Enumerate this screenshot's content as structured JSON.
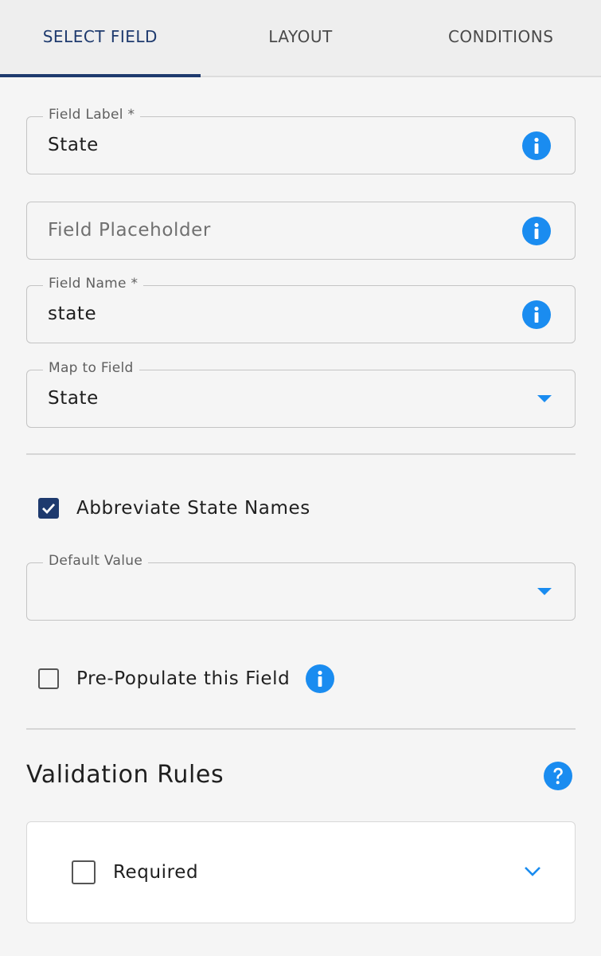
{
  "tabs": [
    {
      "label": "SELECT FIELD",
      "active": true
    },
    {
      "label": "LAYOUT",
      "active": false
    },
    {
      "label": "CONDITIONS",
      "active": false
    }
  ],
  "fields": {
    "field_label": {
      "legend": "Field Label *",
      "value": "State",
      "icon": "info-icon"
    },
    "field_placeholder": {
      "placeholder": "Field Placeholder",
      "value": "",
      "icon": "info-icon"
    },
    "field_name": {
      "legend": "Field Name *",
      "value": "state",
      "icon": "info-icon"
    },
    "map_to_field": {
      "legend": "Map to Field",
      "value": "State",
      "icon": "caret-down-icon"
    }
  },
  "abbreviate": {
    "label": "Abbreviate State Names",
    "checked": true
  },
  "default_value": {
    "legend": "Default Value",
    "value": "",
    "icon": "caret-down-icon"
  },
  "prepopulate": {
    "label": "Pre-Populate this Field",
    "checked": false,
    "icon": "info-icon"
  },
  "validation": {
    "title": "Validation Rules",
    "help_icon": "question-circle-icon",
    "rules": [
      {
        "label": "Required",
        "checked": false,
        "icon": "chevron-down-icon"
      }
    ]
  },
  "colors": {
    "accent_navy": "#1e3a6e",
    "info_blue": "#1a8cf0",
    "background": "#f5f5f5"
  }
}
